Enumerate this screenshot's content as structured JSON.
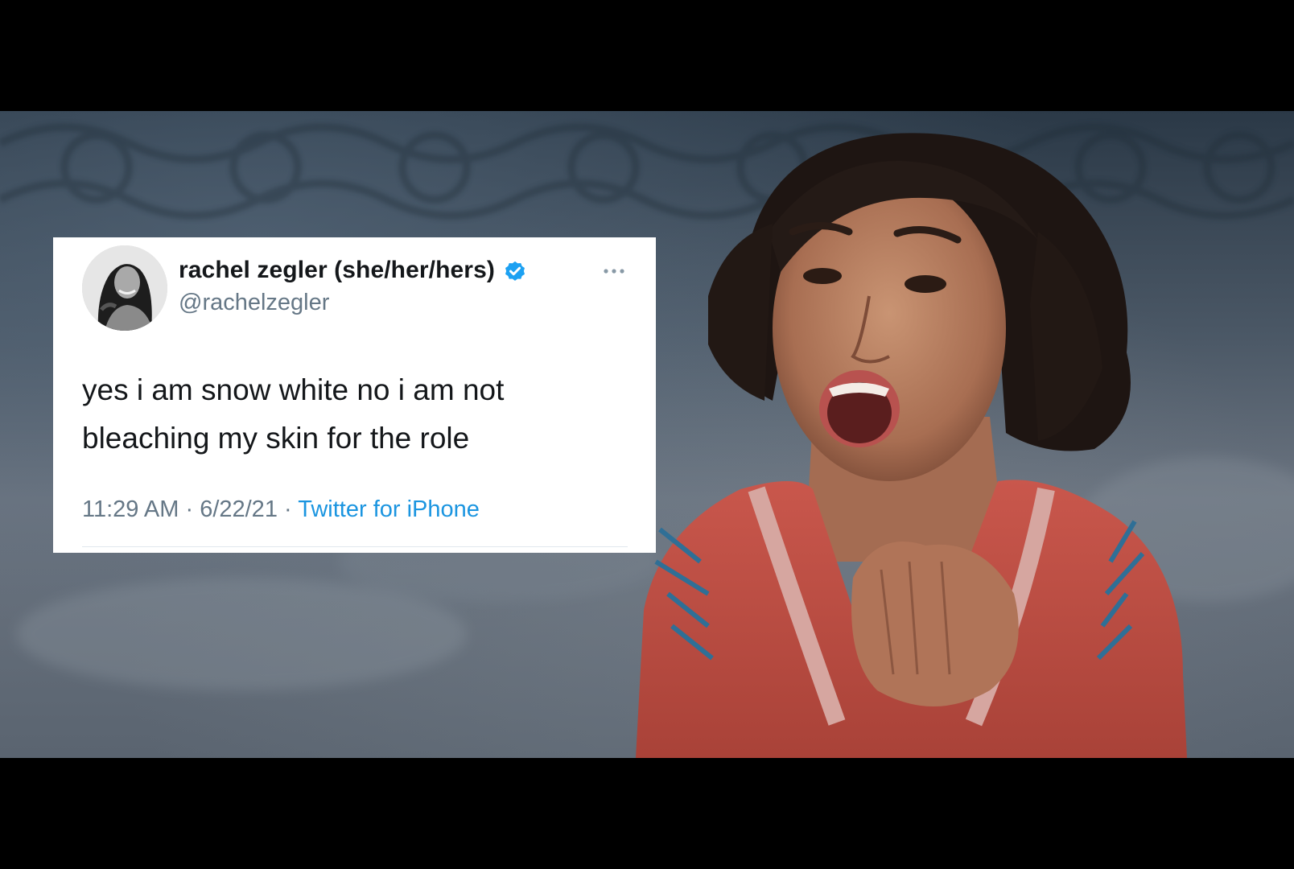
{
  "tweet": {
    "display_name": "rachel zegler (she/her/hers)",
    "handle": "@rachelzegler",
    "verified": true,
    "text_lines": [
      "yes i am snow white no i am not",
      "bleaching my skin for the role"
    ],
    "time": "11:29 AM",
    "separator": "·",
    "date": "6/22/21",
    "source": "Twitter for iPhone",
    "icons": {
      "verified": "verified-badge-icon",
      "more": "more-options-icon"
    }
  },
  "colors": {
    "name": "#14171a",
    "secondary": "#657786",
    "link": "#1b95e0",
    "verified": "#1da1f2",
    "card_bg": "#ffffff",
    "letterbox": "#000000"
  }
}
